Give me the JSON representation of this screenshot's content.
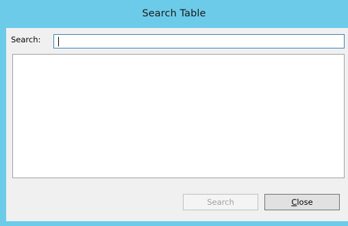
{
  "window": {
    "title": "Search Table"
  },
  "search": {
    "label": "Search:",
    "value": ""
  },
  "results": {
    "items": []
  },
  "buttons": {
    "search_label": "Search",
    "close_mnemonic": "C",
    "close_rest": "lose"
  },
  "colors": {
    "titlebar": "#6ccbe9",
    "client": "#f0f0f0",
    "input_border": "#3c7fb1"
  }
}
